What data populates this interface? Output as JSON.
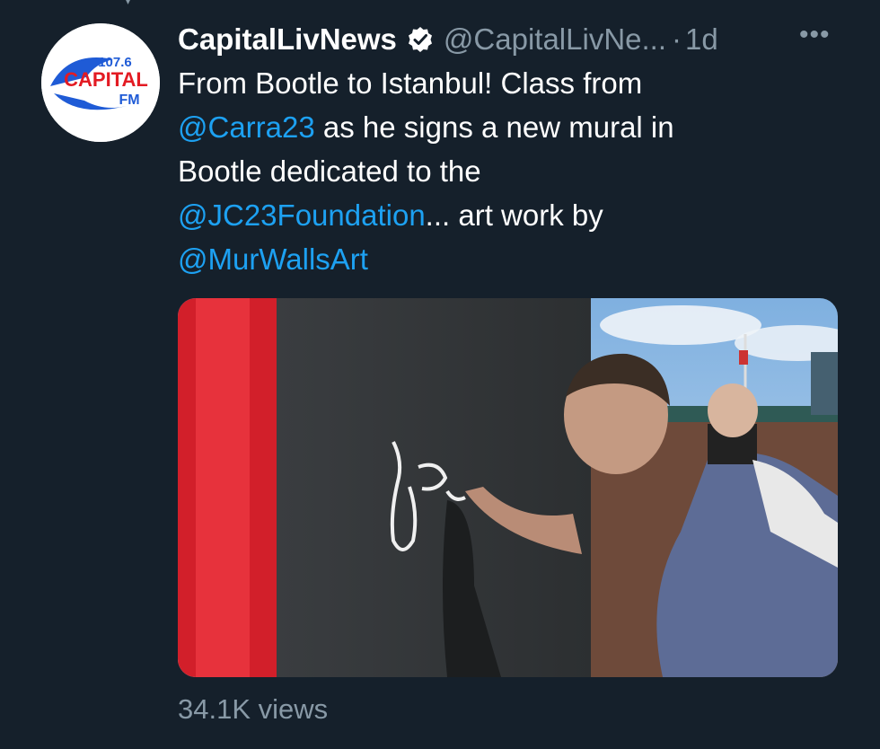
{
  "tweet": {
    "display_name": "CapitalLivNews",
    "handle": "@CapitalLivNe...",
    "separator": "·",
    "time": "1d",
    "more_glyph": "•••",
    "text": {
      "line1": "From Bootle to Istanbul! Class from",
      "mention1": "@Carra23",
      "line2_rest": " as he signs a new mural in",
      "line3": "Bootle dedicated to the",
      "mention2": "@JC23Foundation",
      "line4_rest": "... art work by",
      "mention3": "@MurWallsArt"
    },
    "views": "34.1K views"
  },
  "avatar": {
    "logo_freq": "107.6",
    "logo_name": "CAPITAL",
    "logo_fm": "FM",
    "brand_color": "#1f5bd6"
  },
  "icons": {
    "verified": "verified-badge-icon",
    "more": "more-options-icon"
  },
  "colors": {
    "background": "#15202b",
    "text": "#ffffff",
    "secondary": "#8899a6",
    "link": "#1da1f2"
  }
}
